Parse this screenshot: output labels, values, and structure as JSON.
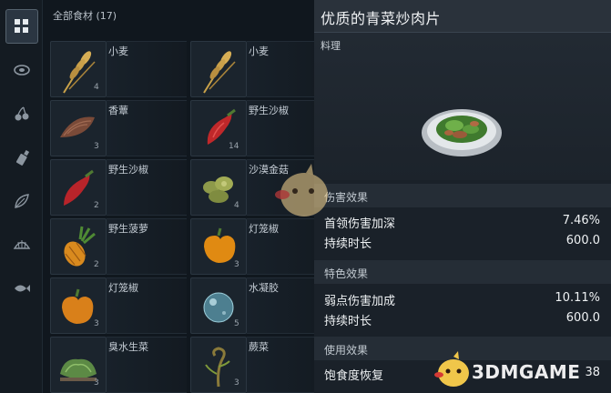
{
  "categories": [
    {
      "icon": "grid-icon",
      "active": true
    },
    {
      "icon": "meat-icon",
      "active": false
    },
    {
      "icon": "cherry-icon",
      "active": false
    },
    {
      "icon": "shaker-icon",
      "active": false
    },
    {
      "icon": "leaf-icon",
      "active": false
    },
    {
      "icon": "shell-icon",
      "active": false
    },
    {
      "icon": "fish-icon",
      "active": false
    }
  ],
  "grid": {
    "title": "全部食材 (17)",
    "items": [
      {
        "name": "小麦",
        "qty": "4",
        "icon": "wheat-icon"
      },
      {
        "name": "小麦",
        "qty": "",
        "icon": "wheat-icon"
      },
      {
        "name": "香蕈",
        "qty": "3",
        "icon": "mushroom-icon"
      },
      {
        "name": "野生沙椒",
        "qty": "14",
        "icon": "chili-icon"
      },
      {
        "name": "野生沙椒",
        "qty": "2",
        "icon": "chili-icon"
      },
      {
        "name": "沙漠金菇",
        "qty": "4",
        "icon": "golden-mushroom-icon"
      },
      {
        "name": "野生菠萝",
        "qty": "2",
        "icon": "pineapple-icon"
      },
      {
        "name": "灯笼椒",
        "qty": "3",
        "icon": "bell-pepper-icon"
      },
      {
        "name": "灯笼椒",
        "qty": "3",
        "icon": "bell-pepper-icon"
      },
      {
        "name": "水凝胶",
        "qty": "5",
        "icon": "hydrogel-icon"
      },
      {
        "name": "臭水生菜",
        "qty": "3",
        "icon": "lettuce-icon"
      },
      {
        "name": "蕨菜",
        "qty": "3",
        "icon": "fern-icon"
      }
    ]
  },
  "detail": {
    "title": "优质的青菜炒肉片",
    "subtitle": "料理",
    "image_icon": "stir-fry-plate-icon",
    "sections": [
      {
        "label": "伤害效果",
        "rows": [
          {
            "key": "首领伤害加深",
            "value": "7.46%"
          },
          {
            "key": "持续时长",
            "value": "600.0"
          }
        ]
      },
      {
        "label": "特色效果",
        "rows": [
          {
            "key": "弱点伤害加成",
            "value": "10.11%"
          },
          {
            "key": "持续时长",
            "value": "600.0"
          }
        ]
      },
      {
        "label": "使用效果",
        "rows": [
          {
            "key": "饱食度恢复",
            "value": "38"
          }
        ]
      }
    ]
  },
  "watermark": {
    "text": "3DMGAME"
  }
}
